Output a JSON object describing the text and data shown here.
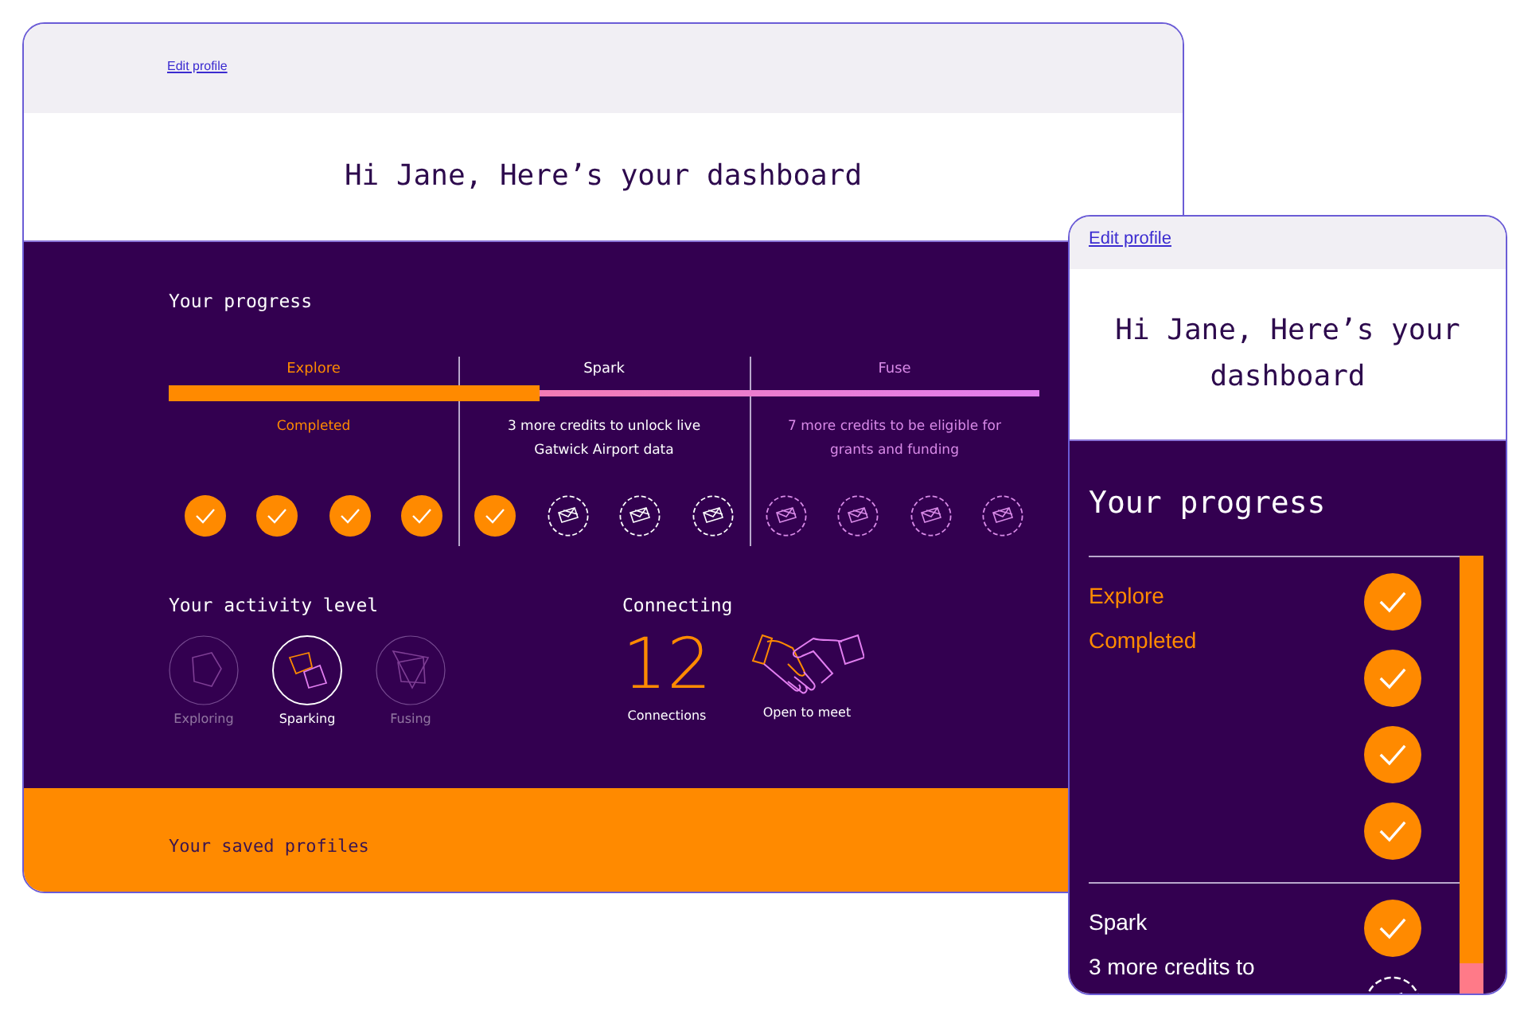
{
  "desktop": {
    "edit_link": "Edit profile",
    "heading": "Hi Jane, Here’s your dashboard",
    "progress": {
      "title": "Your progress",
      "level": 0.426,
      "stages": [
        {
          "name": "Explore",
          "kind": "complete",
          "status": "Completed",
          "steps": [
            {
              "done": true
            },
            {
              "done": true
            },
            {
              "done": true
            },
            {
              "done": true
            }
          ]
        },
        {
          "name": "Spark",
          "kind": "current",
          "status": "3 more credits to unlock live Gatwick Airport data",
          "steps": [
            {
              "done": true
            },
            {
              "done": false
            },
            {
              "done": false
            },
            {
              "done": false
            }
          ]
        },
        {
          "name": "Fuse",
          "kind": "locked",
          "status": "7 more credits to be eligible for grants and funding",
          "steps": [
            {
              "done": false
            },
            {
              "done": false
            },
            {
              "done": false
            },
            {
              "done": false
            }
          ]
        }
      ]
    },
    "activity": {
      "title": "Your activity level",
      "levels": [
        {
          "label": "Exploring",
          "kind": "pentagon",
          "selected": false
        },
        {
          "label": "Sparking",
          "kind": "squares",
          "selected": true
        },
        {
          "label": "Fusing",
          "kind": "triangle",
          "selected": false
        }
      ]
    },
    "connecting": {
      "title": "Connecting",
      "count": "12",
      "count_label": "Connections",
      "meet_label": "Open to meet"
    },
    "saved": {
      "title": "Your saved profiles"
    }
  },
  "mobile": {
    "edit_link": "Edit profile",
    "heading": "Hi Jane, Here’s your dashboard",
    "progress_title": "Your progress",
    "level": 0.93,
    "stages": [
      {
        "name": "Explore",
        "kind": "complete",
        "status": "Completed",
        "steps": [
          {
            "done": true
          },
          {
            "done": true
          },
          {
            "done": true
          },
          {
            "done": true
          }
        ]
      },
      {
        "name": "Spark",
        "kind": "current",
        "status": "3 more credits to",
        "steps": [
          {
            "done": true
          },
          {
            "done": false
          }
        ]
      }
    ]
  }
}
